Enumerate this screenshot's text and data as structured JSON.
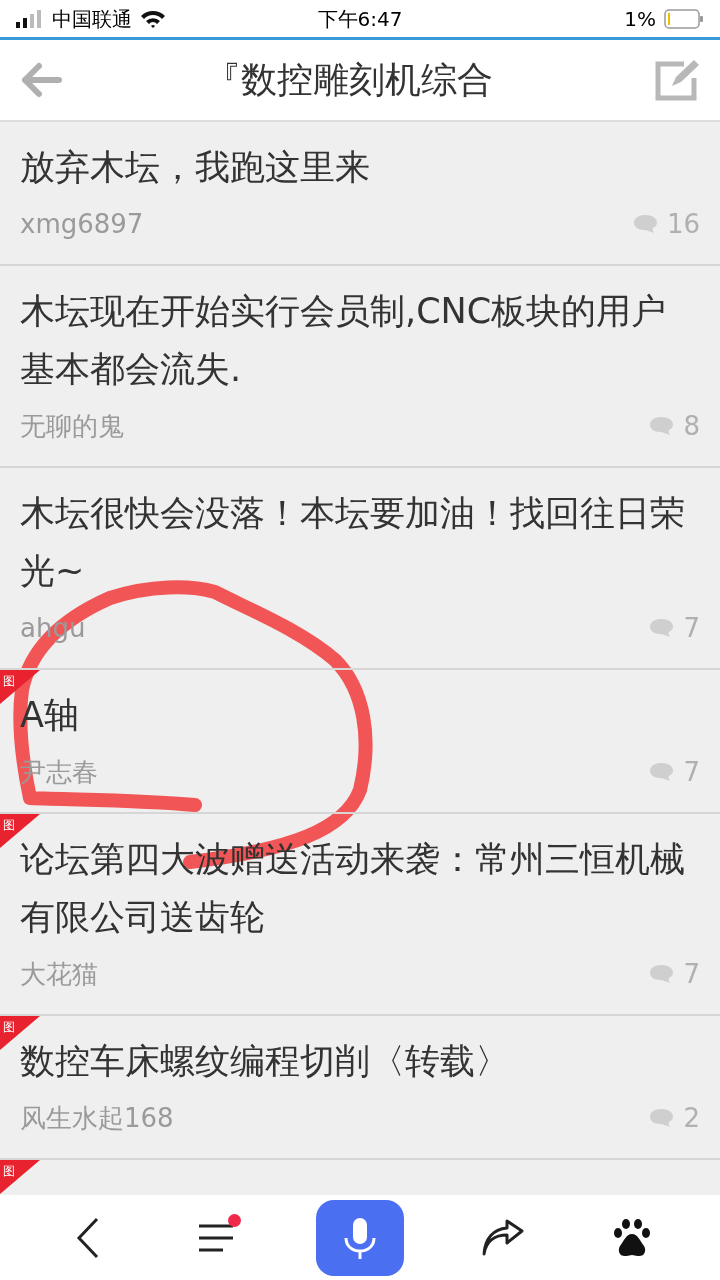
{
  "status_bar": {
    "carrier": "中国联通",
    "time": "下午6:47",
    "battery": "1%"
  },
  "header": {
    "title": "『数控雕刻机综合"
  },
  "posts": [
    {
      "title": "放弃木坛，我跑这里来",
      "author": "xmg6897",
      "replies": "16"
    },
    {
      "title": "木坛现在开始实行会员制,CNC板块的用户基本都会流失.",
      "author": "无聊的鬼",
      "replies": "8"
    },
    {
      "title": "木坛很快会没落！本坛要加油！找回往日荣光~",
      "author": "ahgu",
      "replies": "7"
    },
    {
      "title": "A轴",
      "author": "尹志春",
      "replies": "7",
      "badge": "图"
    },
    {
      "title": "论坛第四大波赠送活动来袭：常州三恒机械有限公司送齿轮",
      "author": "大花猫",
      "replies": "7",
      "badge": "图"
    },
    {
      "title": "数控车床螺纹编程切削〈转载〉",
      "author": "风生水起168",
      "replies": "2",
      "badge": "图"
    },
    {
      "badge": "图"
    }
  ],
  "bottom_bar": {
    "menu_notification": true
  }
}
